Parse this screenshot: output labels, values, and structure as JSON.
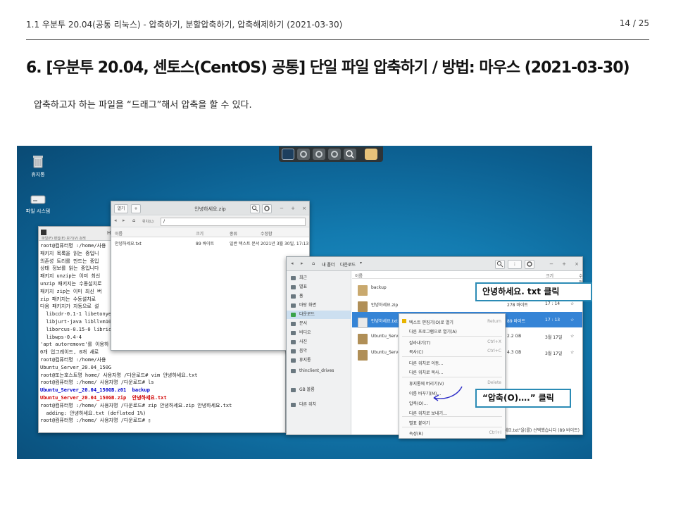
{
  "header": {
    "breadcrumb": "1.1 우분투 20.04(공통 리눅스) - 압축하기, 분할압축하기, 압축해제하기 (2021-03-30)",
    "page": "14 / 25"
  },
  "title": "6. [우분투 20.04, 센토스(CentOS) 공통] 단일 파일 압축하기 / 방법: 마우스 (2021-03-30)",
  "description": "압축하고자 하는 파일을 “드래그”해서 압축을 할 수 있다.",
  "desktop": {
    "icons": [
      {
        "label": "휴지통",
        "icon": "trash-icon"
      },
      {
        "label": "파일 시스템",
        "icon": "drive-icon"
      }
    ]
  },
  "archive_window": {
    "title": "안녕하세요.zip",
    "open_btn": "열기",
    "add_btn": "+",
    "location_label": "위치(L):",
    "location_value": "/",
    "columns": [
      "이름",
      "크기",
      "종류",
      "수정함"
    ],
    "rows": [
      {
        "name": "안녕하세요.txt",
        "size": "89 바이트",
        "type": "일반 텍스트 문서",
        "modified": "2021년 3월 30일, 17:13"
      }
    ]
  },
  "terminal": {
    "menu": "파일(F)  편집(E)  보기(V)  검색",
    "title_fragment": "H",
    "lines": [
      {
        "text": "root@컴퓨터명 :/home/사용",
        "cls": ""
      },
      {
        "text": "패키지 목록을 읽는 중입니",
        "cls": ""
      },
      {
        "text": "의존성 트리를 만드는 중입",
        "cls": ""
      },
      {
        "text": "상태 정보를 읽는 중입니다",
        "cls": ""
      },
      {
        "text": "패키지 unzip는 이미 최신",
        "cls": ""
      },
      {
        "text": "unzip 패키지는 수동설치로",
        "cls": ""
      },
      {
        "text": "패키지 zip는 이미 최신 버",
        "cls": ""
      },
      {
        "text": "zip 패키지는 수동설치로 ",
        "cls": ""
      },
      {
        "text": "다음 패키지가 자동으로 설",
        "cls": ""
      },
      {
        "text": "  libcdr-0.1-1 libetonye",
        "cls": ""
      },
      {
        "text": "  libjurt-java libllvm10",
        "cls": ""
      },
      {
        "text": "  liborcus-0.15-0 libric",
        "cls": ""
      },
      {
        "text": "  libwps-0.4-4",
        "cls": ""
      },
      {
        "text": "'apt autoremove'를 이용하",
        "cls": ""
      },
      {
        "text": "0개 업그레이드, 0개 새로 ",
        "cls": ""
      },
      {
        "text": "root@컴퓨터명 :/home/사용",
        "cls": ""
      },
      {
        "text": "Ubuntu_Server_20.04_150G",
        "cls": ""
      },
      {
        "text": "root@또는호스트명 home/ 사용자명 /다운로드# vim 안녕하세요.txt",
        "cls": ""
      },
      {
        "text": "root@컴퓨터명 :/home/ 사용자명 /다운로드# ls",
        "cls": ""
      },
      {
        "text": "Ubuntu_Server_20.04_150GB.z01  backup",
        "cls": "hl"
      },
      {
        "text": "Ubuntu_Server_20.04_150GB.zip  안녕하세요.txt",
        "cls": "red"
      },
      {
        "text": "root@컴퓨터명 :/home/ 사용자명 /다운로드# zip 안녕하세요.zip 안녕하세요.txt",
        "cls": ""
      },
      {
        "text": "  adding: 안녕하세요.txt (deflated 1%)",
        "cls": ""
      },
      {
        "text": "root@컴퓨터명 :/home/ 사용자명 /다운로드# ▯",
        "cls": ""
      }
    ]
  },
  "file_manager": {
    "path": [
      "내 폴더",
      "다운로드"
    ],
    "sidebar": [
      "최근",
      "별표",
      "홈",
      "바탕 화면",
      "다운로드",
      "문서",
      "비디오",
      "사진",
      "음악",
      "휴지통",
      "thinclient_drives",
      "GB 볼륨",
      "다른 위치"
    ],
    "columns": [
      "이름",
      "크기",
      "수정 시각",
      "별표"
    ],
    "rows": [
      {
        "name": "backup",
        "size": "",
        "date": "",
        "icon": "folder"
      },
      {
        "name": "안녕하세요.zip",
        "size": "278 바이트",
        "date": "17 : 14",
        "icon": "zip"
      },
      {
        "name": "안녕하세요.txt",
        "size": "89 바이트",
        "date": "17 : 13",
        "icon": "file"
      },
      {
        "name": "Ubuntu_Server",
        "size": "2.2 GB",
        "date": "3월 17일",
        "icon": "zip"
      },
      {
        "name": "Ubuntu_Server",
        "size": "4.3 GB",
        "date": "3월 17일",
        "icon": "zip"
      }
    ],
    "status": "\"안녕하세요.txt\"을(를) 선택했습니다 (89 바이트)"
  },
  "context_menu": [
    {
      "label": "텍스트 편집기(O)로 열기",
      "key": "Return"
    },
    {
      "label": "다른 프로그램으로 열기(A)",
      "key": ""
    },
    {
      "label": "잘라내기(T)",
      "key": "Ctrl+X"
    },
    {
      "label": "복사(C)",
      "key": "Ctrl+C"
    },
    {
      "label": "다른 위치로 이동…",
      "key": ""
    },
    {
      "label": "다른 위치로 복사…",
      "key": ""
    },
    {
      "label": "휴지통에 버리기(V)",
      "key": "Delete"
    },
    {
      "label": "이름 바꾸기(M)…",
      "key": "F2"
    },
    {
      "label": "압축(O)…",
      "key": ""
    },
    {
      "label": "다른 위치로 보내기…",
      "key": ""
    },
    {
      "label": "별표 붙이기",
      "key": ""
    },
    {
      "label": "속성(R)",
      "key": "Ctrl+I"
    }
  ],
  "callouts": {
    "click_file": "안녕하세요. txt 클릭",
    "click_compress": "“압축(O)….” 클릭"
  },
  "colors": {
    "accent": "#2b8bb5",
    "selection": "#3584d6",
    "desktop": "#137bb0"
  }
}
